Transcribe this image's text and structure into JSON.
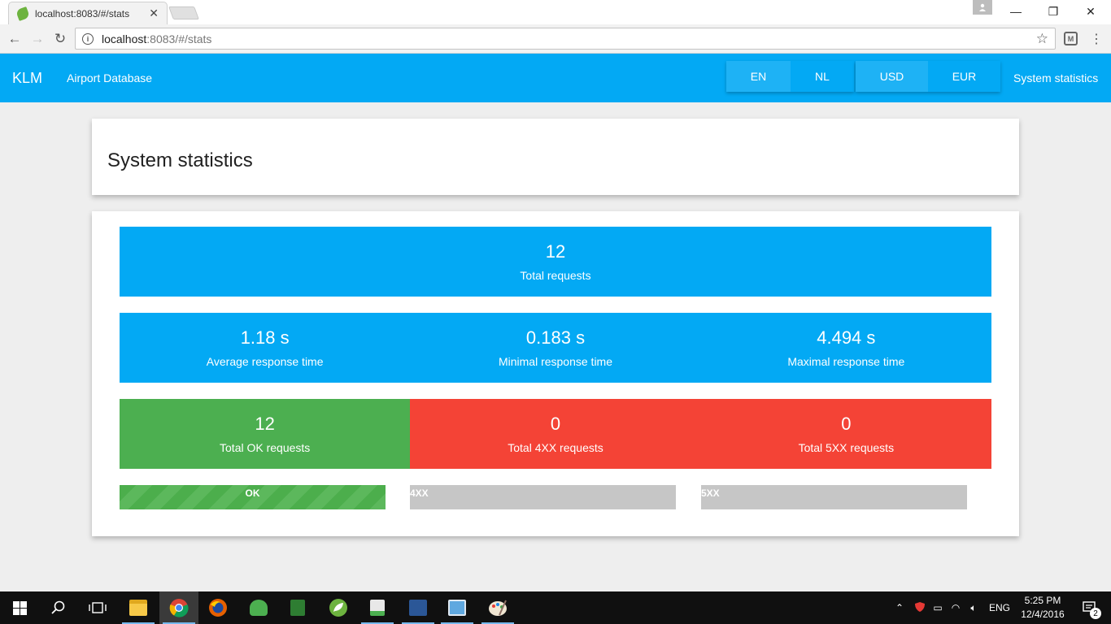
{
  "browser": {
    "tab_title": "localhost:8083/#/stats",
    "tab_close": "✕",
    "url_host": "localhost",
    "url_path": ":8083/#/stats",
    "back": "←",
    "forward": "→",
    "reload": "↻",
    "star": "☆",
    "menu": "⋮",
    "minimize": "—",
    "restore": "❐",
    "close": "✕",
    "ext_label": "M",
    "info_label": "i"
  },
  "header": {
    "brand": "KLM",
    "nav_link": "Airport Database",
    "languages": [
      "EN",
      "NL"
    ],
    "currencies": [
      "USD",
      "EUR"
    ],
    "stats_link": "System statistics"
  },
  "page": {
    "title": "System statistics"
  },
  "stats": {
    "total_requests": {
      "value": "12",
      "label": "Total requests"
    },
    "response_times": [
      {
        "value": "1.18 s",
        "label": "Average response time"
      },
      {
        "value": "0.183 s",
        "label": "Minimal response time"
      },
      {
        "value": "4.494 s",
        "label": "Maximal response time"
      }
    ],
    "status_counts": [
      {
        "value": "12",
        "label": "Total OK requests"
      },
      {
        "value": "0",
        "label": "Total 4XX requests"
      },
      {
        "value": "0",
        "label": "Total 5XX requests"
      }
    ],
    "bars": [
      {
        "label": "OK",
        "fraction": 1.0
      },
      {
        "label": "4XX",
        "fraction": 0.0
      },
      {
        "label": "5XX",
        "fraction": 0.0
      }
    ]
  },
  "colors": {
    "primary": "#03a9f4",
    "success": "#4caf50",
    "danger": "#f44336",
    "bar_track": "#c6c6c6"
  },
  "taskbar": {
    "icons": [
      "windows-start-icon",
      "search-icon",
      "task-view-icon",
      "file-explorer-icon",
      "chrome-icon",
      "firefox-icon",
      "app-icon",
      "notepad-icon",
      "spring-icon",
      "editor-icon",
      "powershell-icon",
      "remote-desktop-icon",
      "paint-icon"
    ],
    "language": "ENG",
    "time": "5:25 PM",
    "date": "12/4/2016",
    "notification_count": "2"
  }
}
